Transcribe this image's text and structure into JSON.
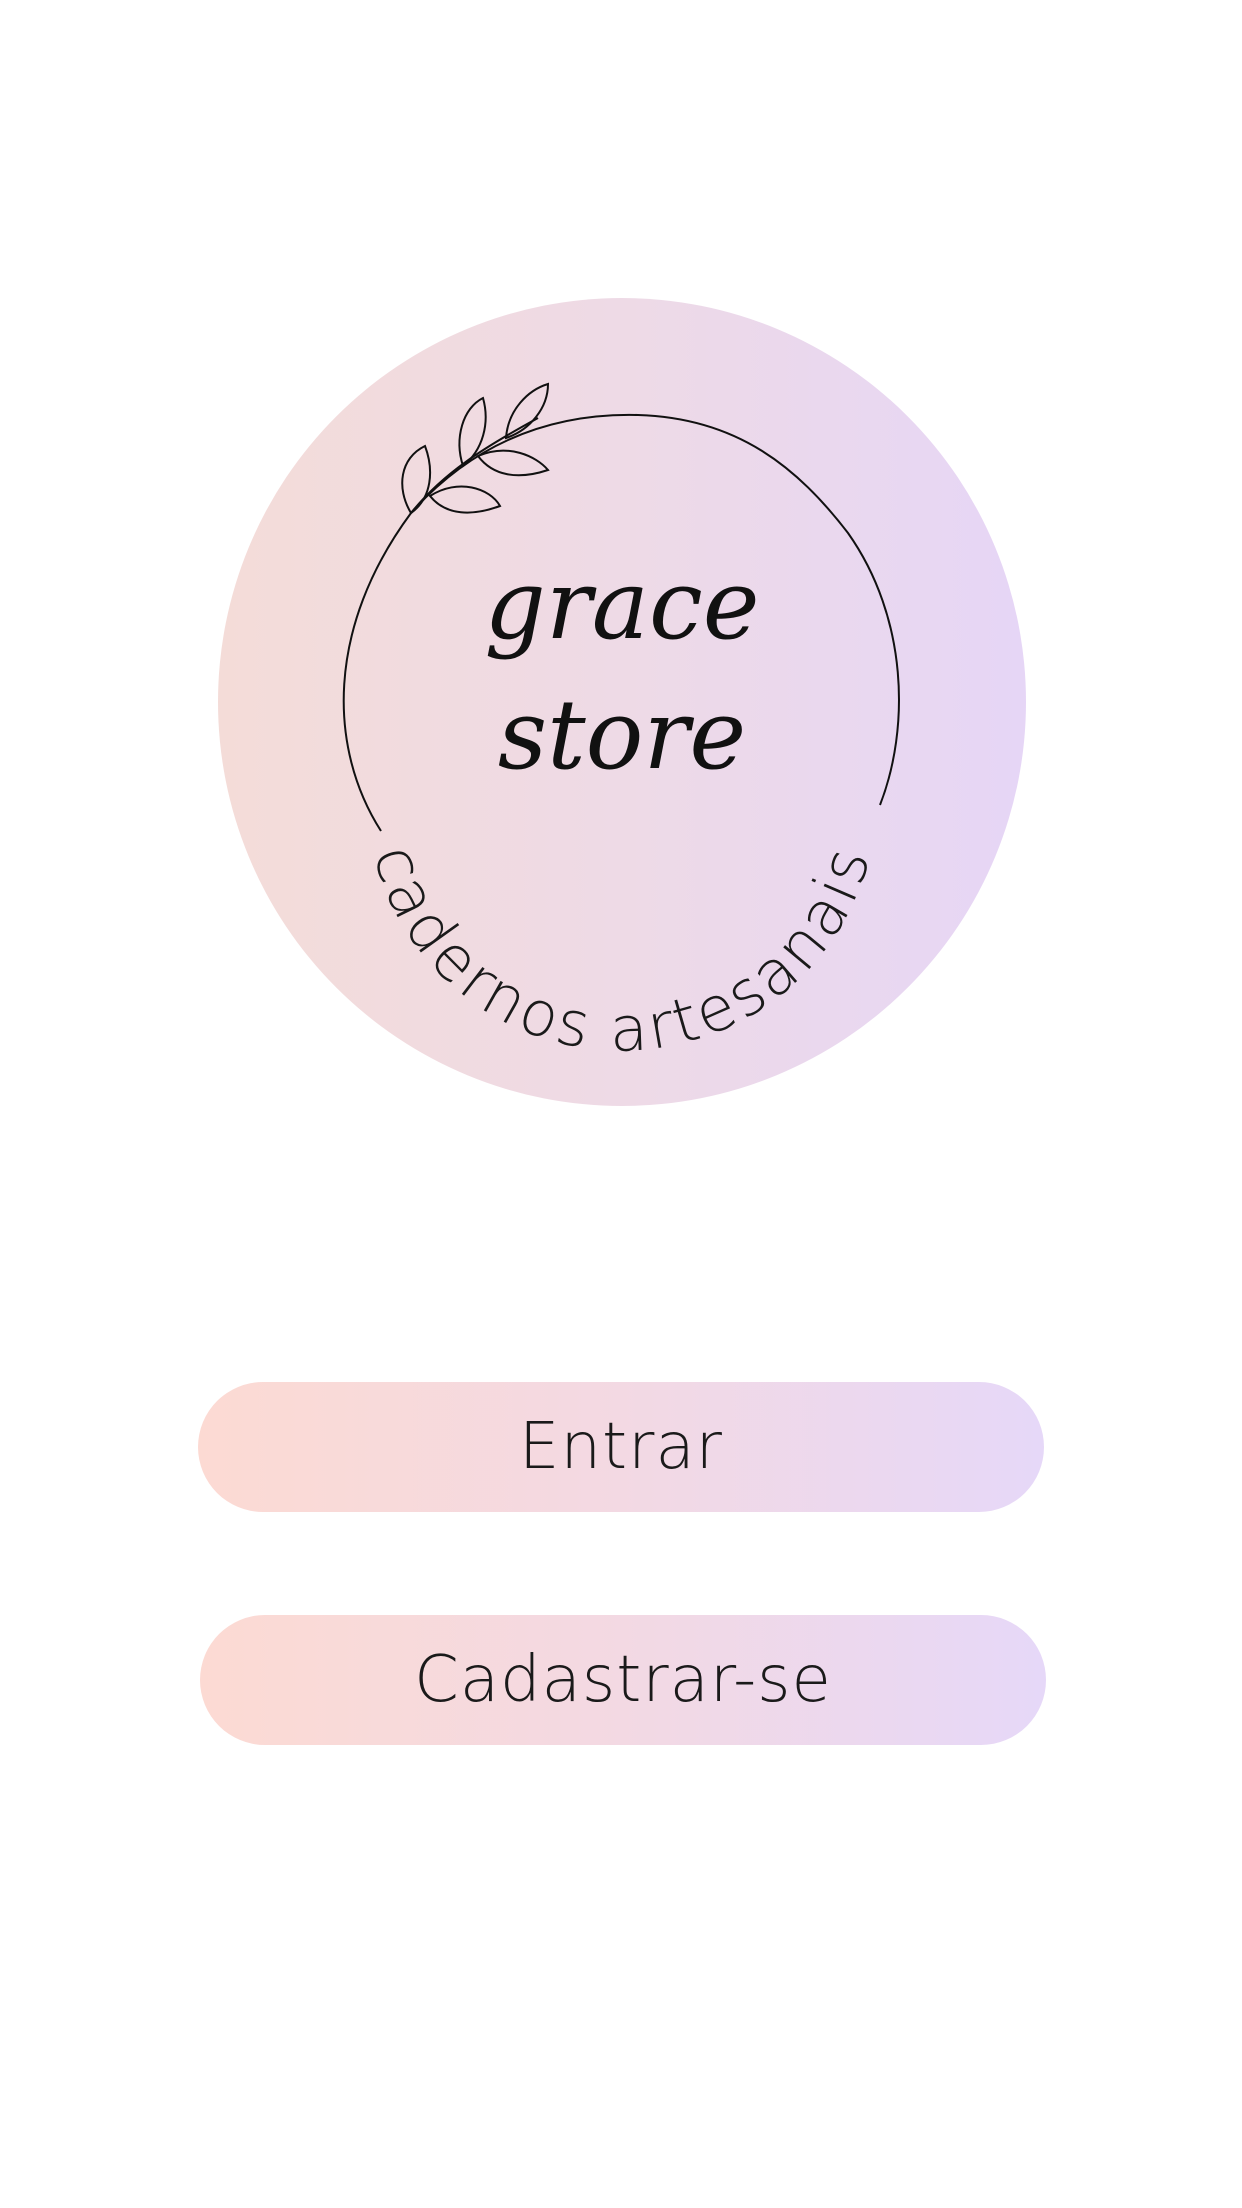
{
  "logo": {
    "title_line1": "grace",
    "title_line2": "store",
    "subtitle": "cadernos artesanais",
    "gradient_start": "#f4dcd8",
    "gradient_end": "#e6d6f6"
  },
  "buttons": {
    "entrar_label": "Entrar",
    "cadastrar_label": "Cadastrar-se",
    "gradient_start": "#fcdad3",
    "gradient_end": "#e6d8f8"
  }
}
